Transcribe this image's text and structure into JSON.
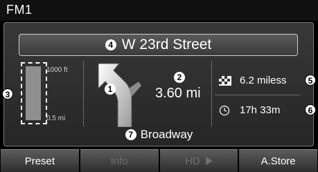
{
  "header": {
    "title": "FM1"
  },
  "navigation": {
    "street": "W 23rd Street",
    "road": "Broadway",
    "distance_to_turn": "3.60 mi",
    "destination_distance": "6.2 miless",
    "eta": "17h 33m",
    "scale_top": "1000 ft",
    "scale_bottom": "0.5 mi",
    "scale_fill_fraction": 1.0
  },
  "callouts": {
    "c1": "1",
    "c2": "2",
    "c3": "3",
    "c4": "4",
    "c5": "5",
    "c6": "6",
    "c7": "7"
  },
  "softkeys": [
    {
      "label": "Preset",
      "enabled": true
    },
    {
      "label": "Info",
      "enabled": false
    },
    {
      "label": "HD",
      "enabled": false
    },
    {
      "label": "A.Store",
      "enabled": true
    }
  ],
  "icons": {
    "turn": "turn-arrow-icon",
    "destination": "checkered-flag-icon",
    "clock": "clock-icon",
    "hd_play": "play-triangle-icon"
  }
}
